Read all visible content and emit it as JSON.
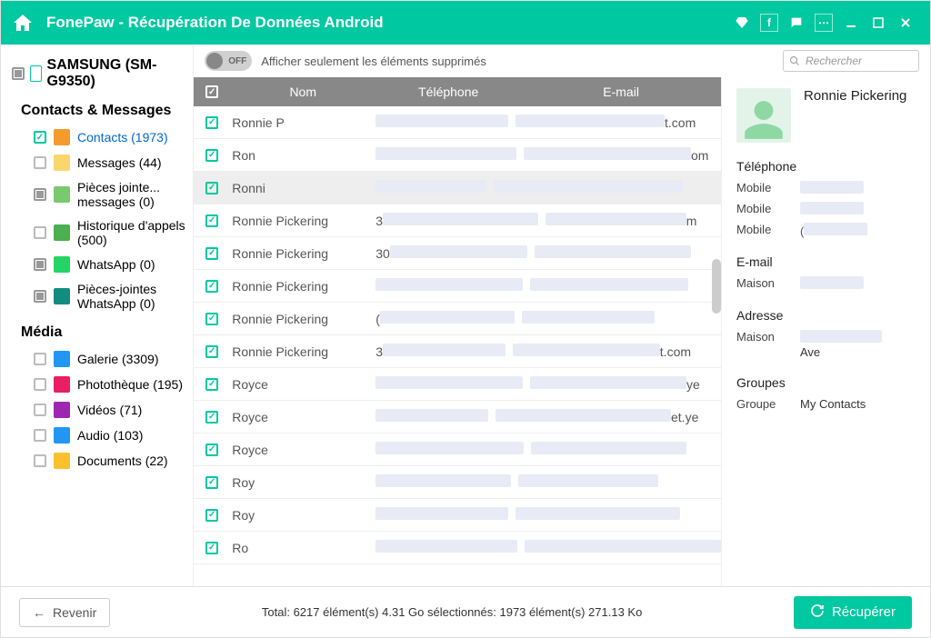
{
  "titlebar": {
    "app_title": "FonePaw - Récupération De Données Android"
  },
  "sidebar": {
    "device_name": "SAMSUNG (SM-G9350)",
    "section1_title": "Contacts & Messages",
    "section2_title": "Média",
    "items_cm": [
      {
        "label": "Contacts (1973)",
        "color": "#f59b2e",
        "check": "checked",
        "active": true
      },
      {
        "label": "Messages (44)",
        "color": "#f9d76d",
        "check": ""
      },
      {
        "label": "Pièces jointe... messages (0)",
        "color": "#7bc96f",
        "check": "indet"
      },
      {
        "label": "Historique d'appels (500)",
        "color": "#4caf50",
        "check": ""
      },
      {
        "label": "WhatsApp (0)",
        "color": "#25d366",
        "check": "indet"
      },
      {
        "label": "Pièces-jointes WhatsApp (0)",
        "color": "#128c7e",
        "check": "indet"
      }
    ],
    "items_media": [
      {
        "label": "Galerie (3309)",
        "color": "#2196f3"
      },
      {
        "label": "Photothèque (195)",
        "color": "#e91e63"
      },
      {
        "label": "Vidéos (71)",
        "color": "#9c27b0"
      },
      {
        "label": "Audio (103)",
        "color": "#2196f3"
      },
      {
        "label": "Documents (22)",
        "color": "#fbc02d"
      }
    ]
  },
  "toolbar": {
    "toggle_state": "OFF",
    "toggle_label": "Afficher seulement les éléments supprimés",
    "search_placeholder": "Rechercher"
  },
  "table": {
    "headers": {
      "name": "Nom",
      "phone": "Téléphone",
      "email": "E-mail"
    },
    "rows": [
      {
        "name": "Ronnie P",
        "email_suffix": "t.com",
        "sel": false
      },
      {
        "name": "Ron",
        "email_suffix": "om",
        "sel": false
      },
      {
        "name": "Ronni",
        "email_suffix": "",
        "sel": true
      },
      {
        "name": "Ronnie Pickering",
        "prefix": "3",
        "email_suffix": "m",
        "sel": false
      },
      {
        "name": "Ronnie Pickering",
        "prefix": "30",
        "email_suffix": "",
        "sel": false
      },
      {
        "name": "Ronnie Pickering",
        "email_suffix": "",
        "sel": false
      },
      {
        "name": "Ronnie Pickering",
        "prefix": "(",
        "email_suffix": "",
        "sel": false
      },
      {
        "name": "Ronnie Pickering",
        "prefix": "3",
        "email_suffix": "t.com",
        "sel": false
      },
      {
        "name": "Royce",
        "email_suffix": "ye",
        "sel": false
      },
      {
        "name": "Royce",
        "email_suffix": "et.ye",
        "sel": false
      },
      {
        "name": "Royce",
        "email_suffix": "",
        "sel": false
      },
      {
        "name": "Roy",
        "email_suffix": "",
        "sel": false
      },
      {
        "name": "Roy",
        "email_suffix": "",
        "sel": false
      },
      {
        "name": "Ro",
        "email_suffix": "",
        "sel": false
      }
    ]
  },
  "detail": {
    "name": "Ronnie Pickering",
    "phone_title": "Téléphone",
    "phone_rows": [
      {
        "label": "Mobile",
        "val": ""
      },
      {
        "label": "Mobile",
        "val": ""
      },
      {
        "label": "Mobile",
        "val": "("
      }
    ],
    "email_title": "E-mail",
    "email_rows": [
      {
        "label": "Maison",
        "val": ""
      }
    ],
    "addr_title": "Adresse",
    "addr_rows": [
      {
        "label": "Maison",
        "val": "Ave"
      }
    ],
    "group_title": "Groupes",
    "group_rows": [
      {
        "label": "Groupe",
        "val": "My Contacts"
      }
    ]
  },
  "footer": {
    "back": "Revenir",
    "status": "Total: 6217 élément(s) 4.31 Go    sélectionnés: 1973 élément(s) 271.13 Ko",
    "recover": "Récupérer"
  }
}
